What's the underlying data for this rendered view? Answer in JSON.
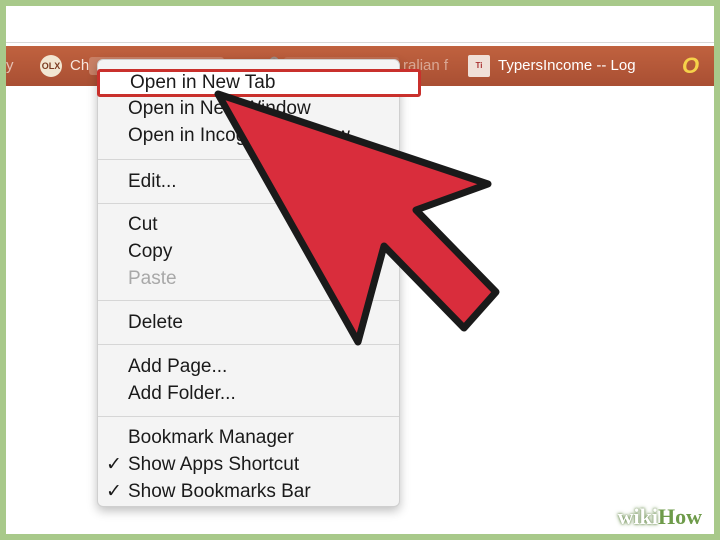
{
  "bookmarks_bar": {
    "items": [
      {
        "label": "y",
        "icon": "bookmark-fragment"
      },
      {
        "label": "Ch",
        "badge": "OLX",
        "icon": "olx-icon"
      },
      {
        "label": "ralian f",
        "icon": "link-icon"
      },
      {
        "label": "TypersIncome -- Log",
        "badge": "Ti",
        "icon": "typersincome-icon"
      },
      {
        "label": "O",
        "icon": "opera-icon"
      }
    ]
  },
  "context_menu": {
    "groups": [
      {
        "items": [
          {
            "label": "Open in New Tab",
            "state": "highlighted"
          },
          {
            "label": "Open in New Window"
          },
          {
            "label": "Open in Incognito Window"
          }
        ]
      },
      {
        "items": [
          {
            "label": "Edit..."
          }
        ]
      },
      {
        "items": [
          {
            "label": "Cut"
          },
          {
            "label": "Copy"
          },
          {
            "label": "Paste",
            "state": "disabled"
          }
        ]
      },
      {
        "items": [
          {
            "label": "Delete"
          }
        ]
      },
      {
        "items": [
          {
            "label": "Add Page..."
          },
          {
            "label": "Add Folder..."
          }
        ]
      },
      {
        "items": [
          {
            "label": "Bookmark Manager"
          },
          {
            "label": "Show Apps Shortcut",
            "checked": true
          },
          {
            "label": "Show Bookmarks Bar",
            "checked": true
          }
        ]
      }
    ],
    "check_glyph": "✓"
  },
  "overlay": {
    "icon": "pointer-arrow-icon",
    "color": "#d92d3c"
  },
  "watermark": {
    "part1": "wiki",
    "part2": "How"
  },
  "colors": {
    "bar": "#b5573a",
    "highlight_border": "#c9302c",
    "frame": "#a8c98a"
  }
}
